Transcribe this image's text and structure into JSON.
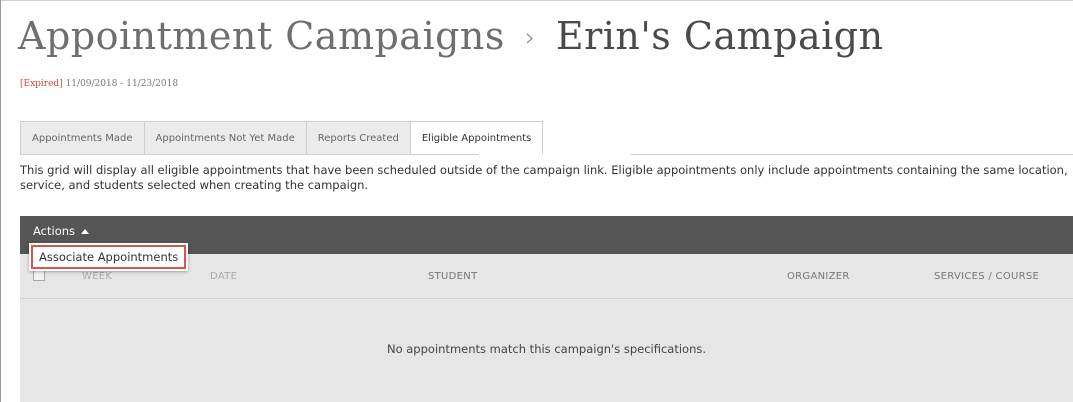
{
  "breadcrumb": {
    "parent": "Appointment Campaigns",
    "separator": "›",
    "current": "Erin's Campaign"
  },
  "campaign": {
    "status": "[Expired]",
    "date_range": "11/09/2018 - 11/23/2018"
  },
  "tabs": [
    {
      "label": "Appointments Made",
      "active": false
    },
    {
      "label": "Appointments Not Yet Made",
      "active": false
    },
    {
      "label": "Reports Created",
      "active": false
    },
    {
      "label": "Eligible Appointments",
      "active": true
    }
  ],
  "description": "This grid will display all eligible appointments that have been scheduled outside of the campaign link. Eligible appointments only include appointments containing the same location, service, and students selected when creating the campaign.",
  "grid": {
    "actions_label": "Actions",
    "actions_menu": [
      {
        "label": "Associate Appointments"
      }
    ],
    "columns": [
      "WEEK",
      "DATE",
      "STUDENT",
      "ORGANIZER",
      "SERVICES / COURSE"
    ],
    "empty_message": "No appointments match this campaign's specifications."
  },
  "colors": {
    "expired": "#d24a3a",
    "actions_bar": "#555555",
    "grid_bg": "#e6e6e6",
    "highlight_border": "#d9534f"
  }
}
